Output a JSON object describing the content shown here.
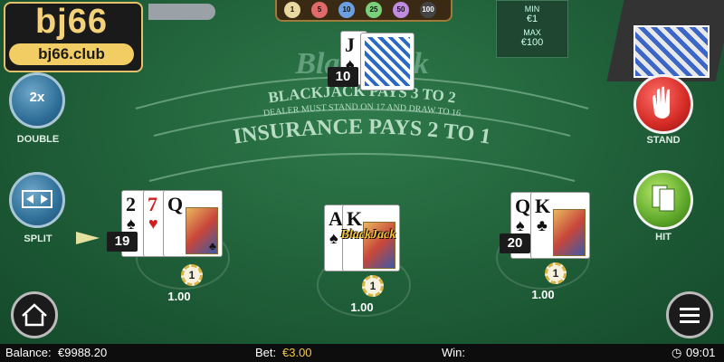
{
  "brand": {
    "logo_text": "bj66",
    "url_text": "bj66.club"
  },
  "table": {
    "felt_title": "BlackJack",
    "line1": "BLACKJACK PAYS 3 TO 2",
    "line2": "DEALER MUST STAND ON 17 AND DRAW TO 16",
    "line3": "INSURANCE PAYS 2 TO 1"
  },
  "limits": {
    "min_label": "MIN",
    "min_value": "€1",
    "max_label": "MAX",
    "max_value": "€100"
  },
  "chip_strip": [
    "1",
    "5",
    "10",
    "25",
    "50",
    "100"
  ],
  "dealer": {
    "score": "10",
    "cards": [
      {
        "rank": "J",
        "suit": "♠",
        "color": "black"
      }
    ]
  },
  "controls": {
    "double_label": "DOUBLE",
    "double_icon_text": "2x",
    "split_label": "SPLIT",
    "stand_label": "STAND",
    "hit_label": "HIT"
  },
  "hands": [
    {
      "score": "19",
      "bet": "1.00",
      "chip": "1",
      "cards": [
        {
          "rank": "2",
          "suit": "♠",
          "color": "black"
        },
        {
          "rank": "7",
          "suit": "♥",
          "color": "red"
        },
        {
          "rank": "Q",
          "suit": "♣",
          "color": "black"
        }
      ]
    },
    {
      "badge": "BlackJack",
      "bet": "1.00",
      "chip": "1",
      "cards": [
        {
          "rank": "A",
          "suit": "♠",
          "color": "black"
        },
        {
          "rank": "K",
          "suit": "♣",
          "color": "black"
        }
      ]
    },
    {
      "score": "20",
      "bet": "1.00",
      "chip": "1",
      "cards": [
        {
          "rank": "Q",
          "suit": "♠",
          "color": "black"
        },
        {
          "rank": "K",
          "suit": "♣",
          "color": "black"
        }
      ]
    }
  ],
  "status_bar": {
    "balance_label": "Balance:",
    "balance_value": "€9988.20",
    "bet_label": "Bet:",
    "bet_value": "€3.00",
    "win_label": "Win:",
    "time": "09:01"
  },
  "colors": {
    "felt": "#1f5e38",
    "stand": "#d42a24",
    "hit": "#5ea82a",
    "action": "#2f6f98"
  }
}
